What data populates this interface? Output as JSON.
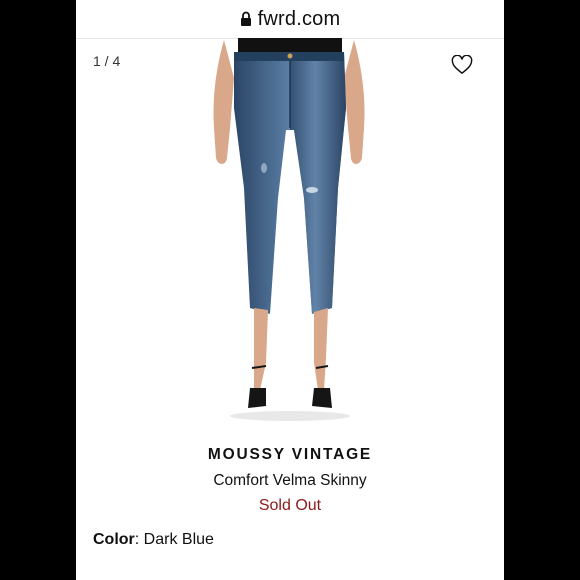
{
  "browser": {
    "url": "fwrd.com",
    "lock_icon": "lock-icon"
  },
  "gallery": {
    "counter": "1 / 4",
    "wishlist_icon": "heart-outline-icon"
  },
  "product": {
    "brand": "MOUSSY VINTAGE",
    "name": "Comfort Velma Skinny",
    "status": "Sold Out",
    "color_label": "Color",
    "color_separator": ": ",
    "color_value": "Dark Blue"
  },
  "colors": {
    "sold_out": "#8b1a1a",
    "denim": "#3a5a82",
    "frame": "#000000"
  }
}
